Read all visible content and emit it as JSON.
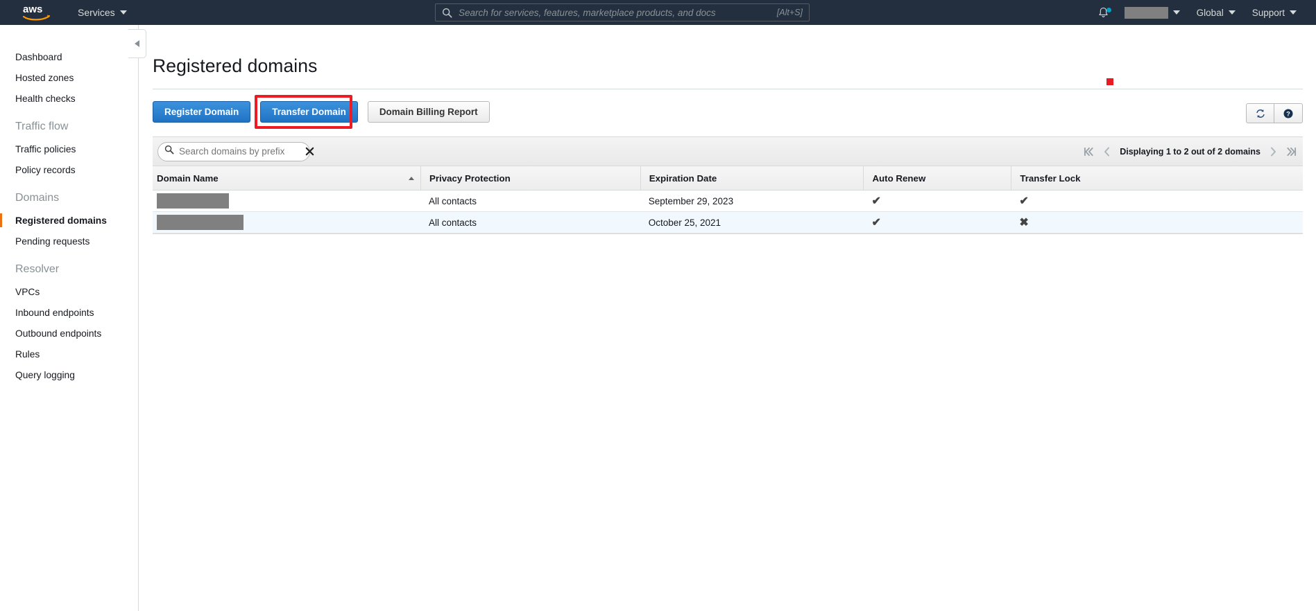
{
  "topnav": {
    "logo_alt": "aws",
    "services_label": "Services",
    "search_placeholder": "Search for services, features, marketplace products, and docs",
    "search_value": "",
    "search_shortcut": "[Alt+S]",
    "account_label": "",
    "region_label": "Global",
    "support_label": "Support",
    "bg_color": "#232f3e"
  },
  "sidebar": {
    "items": [
      {
        "label": "Dashboard",
        "type": "link",
        "active": false
      },
      {
        "label": "Hosted zones",
        "type": "link",
        "active": false
      },
      {
        "label": "Health checks",
        "type": "link",
        "active": false
      },
      {
        "label": "Traffic flow",
        "type": "group",
        "active": false
      },
      {
        "label": "Traffic policies",
        "type": "link",
        "active": false
      },
      {
        "label": "Policy records",
        "type": "link",
        "active": false
      },
      {
        "label": "Domains",
        "type": "group",
        "active": false
      },
      {
        "label": "Registered domains",
        "type": "link",
        "active": true
      },
      {
        "label": "Pending requests",
        "type": "link",
        "active": false
      },
      {
        "label": "Resolver",
        "type": "group",
        "active": false
      },
      {
        "label": "VPCs",
        "type": "link",
        "active": false
      },
      {
        "label": "Inbound endpoints",
        "type": "link",
        "active": false
      },
      {
        "label": "Outbound endpoints",
        "type": "link",
        "active": false
      },
      {
        "label": "Rules",
        "type": "link",
        "active": false
      },
      {
        "label": "Query logging",
        "type": "link",
        "active": false
      }
    ],
    "active_accent_color": "#ec7211"
  },
  "main": {
    "page_title": "Registered domains",
    "buttons": [
      {
        "label": "Register Domain",
        "style": "primary",
        "highlighted": false
      },
      {
        "label": "Transfer Domain",
        "style": "primary",
        "highlighted": true
      },
      {
        "label": "Domain Billing Report",
        "style": "default",
        "highlighted": false
      }
    ],
    "highlight_color": "#ed1c24",
    "cursor_marker_color": "#e81b23",
    "icon_buttons": [
      {
        "name": "refresh",
        "title": "Refresh"
      },
      {
        "name": "help",
        "title": "Help"
      }
    ],
    "toolbar": {
      "search_placeholder": "Search domains by prefix",
      "search_value": "",
      "clear_label": "✕",
      "pagination_text": "Displaying 1 to 2 out of 2 domains"
    },
    "table": {
      "columns": [
        {
          "label": "Domain Name",
          "sorted": "asc"
        },
        {
          "label": "Privacy Protection",
          "sorted": ""
        },
        {
          "label": "Expiration Date",
          "sorted": ""
        },
        {
          "label": "Auto Renew",
          "sorted": ""
        },
        {
          "label": "Transfer Lock",
          "sorted": ""
        }
      ],
      "rows": [
        {
          "domain_name": "",
          "domain_redacted_width": 104,
          "privacy_protection": "All contacts",
          "expiration_date": "September 29, 2023",
          "auto_renew": "✔",
          "transfer_lock": "✔"
        },
        {
          "domain_name": "",
          "domain_redacted_width": 125,
          "privacy_protection": "All contacts",
          "expiration_date": "October 25, 2021",
          "auto_renew": "✔",
          "transfer_lock": "✖"
        }
      ]
    }
  }
}
